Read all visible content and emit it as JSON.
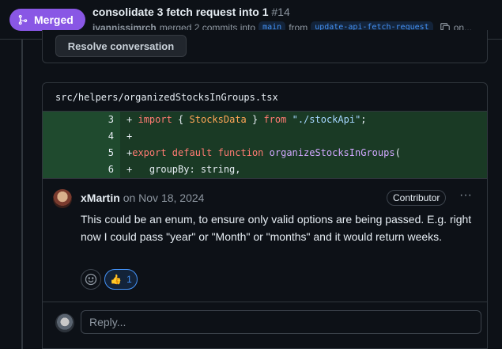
{
  "header": {
    "status_label": "Merged",
    "title": "consolidate 3 fetch request into 1",
    "number": "#14",
    "author": "ivannissimrch",
    "meta_text": "merged 2 commits into",
    "base_branch": "main",
    "from_text": "from",
    "head_branch": "update-api-fetch-request",
    "overflow_text": "on..."
  },
  "previous": {
    "resolve_label": "Resolve conversation"
  },
  "thread": {
    "file_path": "src/helpers/organizedStocksInGroups.tsx",
    "diff_lines": [
      {
        "line": "3",
        "sign": "+"
      },
      {
        "line": "4",
        "sign": "+"
      },
      {
        "line": "5",
        "sign": "+"
      },
      {
        "line": "6",
        "sign": "+"
      }
    ],
    "comment": {
      "author": "xMartin",
      "on_text": "on",
      "date": "Nov 18, 2024",
      "badge": "Contributor",
      "body": "This could be an enum, to ensure only valid options are being passed. E.g. right now I could pass \"year\" or \"Month\" or \"months\" and it would return weeks.",
      "reactions": [
        {
          "emoji": "👍",
          "count": "1"
        }
      ]
    },
    "reply": {
      "placeholder": "Reply..."
    }
  },
  "colors": {
    "merged": "#8957e5",
    "diff_added_bg": "#1a3a25",
    "link": "#4493f8"
  }
}
